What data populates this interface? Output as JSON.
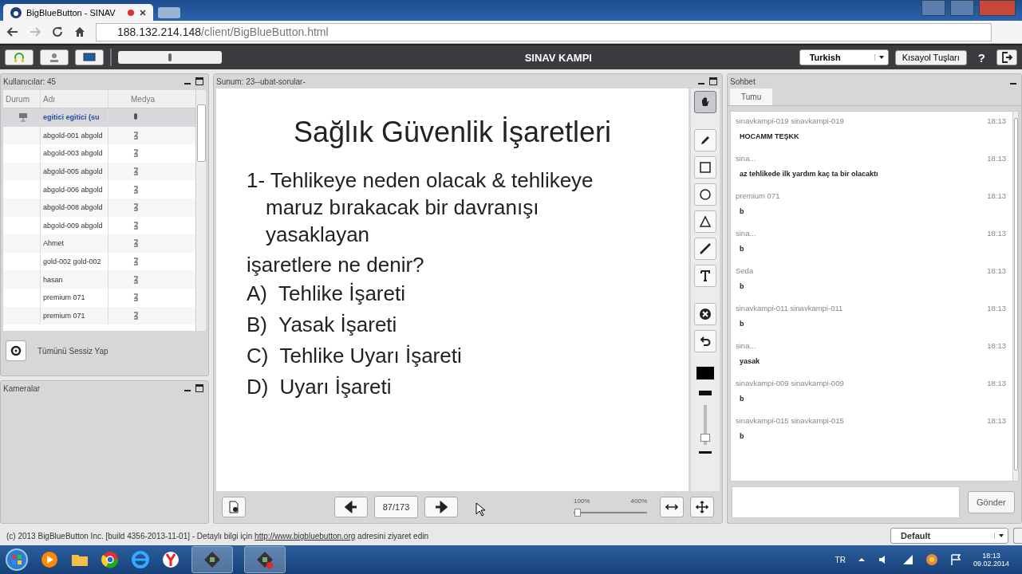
{
  "browser": {
    "tab_title": "BigBlueButton - SINAV",
    "url_host": "188.132.214.148",
    "url_path": "/client/BigBlueButton.html"
  },
  "toolbar": {
    "title": "SINAV KAMPI",
    "language": "Turkish",
    "shortcuts_button": "Kısayol Tuşları",
    "help": "?"
  },
  "users": {
    "title": "Kullanıcılar: 45",
    "columns": [
      "Durum",
      "Adı",
      "Medya"
    ],
    "rows": [
      {
        "name": "egitici egitici (su",
        "presenter": true,
        "selected": true
      },
      {
        "name": "abgold-001 abgold",
        "presenter": false,
        "selected": false
      },
      {
        "name": "abgold-003 abgold",
        "presenter": false,
        "selected": false
      },
      {
        "name": "abgold-005 abgold",
        "presenter": false,
        "selected": false
      },
      {
        "name": "abgold-006 abgold",
        "presenter": false,
        "selected": false
      },
      {
        "name": "abgold-008 abgold",
        "presenter": false,
        "selected": false
      },
      {
        "name": "abgold-009 abgold",
        "presenter": false,
        "selected": false
      },
      {
        "name": "Ahmet",
        "presenter": false,
        "selected": false
      },
      {
        "name": "gold-002 gold-002",
        "presenter": false,
        "selected": false
      },
      {
        "name": "hasan",
        "presenter": false,
        "selected": false
      },
      {
        "name": "premium 071",
        "presenter": false,
        "selected": false
      },
      {
        "name": "premium 071",
        "presenter": false,
        "selected": false
      }
    ],
    "mute_all": "Tümünü Sessiz Yap"
  },
  "cameras": {
    "title": "Kameralar"
  },
  "presentation": {
    "title": "Sunum: 23--ubat-sorular-",
    "slide": {
      "heading": "Sağlık Güvenlik İşaretleri",
      "question_lines": [
        "1-  Tehlikeye neden olacak & tehlikeye",
        "maruz bırakacak bir davranışı",
        "yasaklayan"
      ],
      "question_end": "işaretlere ne denir?",
      "options": [
        {
          "letter": "A)",
          "text": "Tehlike İşareti"
        },
        {
          "letter": "B)",
          "text": "Yasak İşareti"
        },
        {
          "letter": "C)",
          "text": "Tehlike Uyarı İşareti"
        },
        {
          "letter": "D)",
          "text": "Uyarı İşareti"
        }
      ]
    },
    "page": "87/173",
    "zoom_min": "100%",
    "zoom_max": "400%",
    "zoom": {
      "level": 0.05
    }
  },
  "tools": [
    {
      "kind": "hand",
      "selected": true
    },
    {
      "kind": "pencil",
      "selected": false
    },
    {
      "kind": "rectangle",
      "selected": false
    },
    {
      "kind": "ellipse",
      "selected": false
    },
    {
      "kind": "triangle",
      "selected": false
    },
    {
      "kind": "line",
      "selected": false
    },
    {
      "kind": "text",
      "selected": false
    },
    {
      "kind": "clear",
      "selected": false
    },
    {
      "kind": "undo",
      "selected": false
    }
  ],
  "chat": {
    "title": "Sohbet",
    "tabs": [
      {
        "label": "Tumu",
        "selected": true
      }
    ],
    "messages": [
      {
        "name": "sinavkampi-019 sinavkampi-019",
        "time": "18:13",
        "text": "HOCAMM TEŞKK"
      },
      {
        "name": "sina...",
        "time": "18:13",
        "text": "az tehlikede ilk yardım kaç ta bir olacaktı"
      },
      {
        "name": "premium 071",
        "time": "18:13",
        "text": "b"
      },
      {
        "name": "sina...",
        "time": "18:13",
        "text": "b"
      },
      {
        "name": "Seda",
        "time": "18:13",
        "text": "b"
      },
      {
        "name": "sinavkampi-011 sinavkampi-011",
        "time": "18:13",
        "text": "b"
      },
      {
        "name": "sina...",
        "time": "18:13",
        "text": "yasak"
      },
      {
        "name": "sinavkampi-009 sinavkampi-009",
        "time": "18:13",
        "text": "b"
      },
      {
        "name": "sinavkampi-015 sinavkampi-015",
        "time": "18:13",
        "text": "b"
      }
    ],
    "send_button": "Gönder"
  },
  "footer": {
    "text_before": "(c) 2013 BigBlueButton Inc. [build 4356-2013-11-01] - Detaylı bilgi için",
    "link": "http://www.bigbluebutton.org",
    "text_after": "adresini ziyaret edin",
    "layout": "Default"
  },
  "taskbar": {
    "language": "TR",
    "time": "18:13",
    "date": "09.02.2014"
  }
}
